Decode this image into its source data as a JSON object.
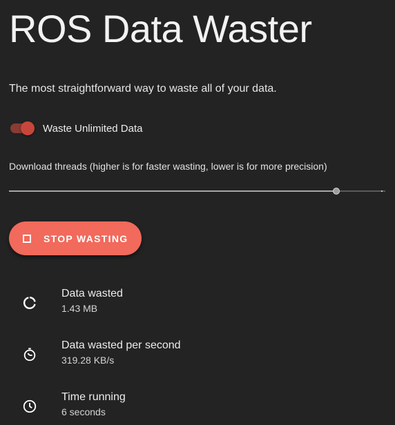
{
  "app": {
    "title": "ROS Data Waster",
    "subtitle": "The most straightforward way to waste all of your data."
  },
  "toggle": {
    "label": "Waste Unlimited Data",
    "checked": true,
    "accent_color": "#c7463c"
  },
  "slider": {
    "label": "Download threads (higher is for faster wasting, lower is for more precision)",
    "level_fraction": 0.87
  },
  "stop_button": {
    "label": "STOP WASTING",
    "icon": "stop-square-icon",
    "color": "#f16a5c"
  },
  "stats": [
    {
      "title": "Data wasted",
      "value": "1.43 MB",
      "icon": "data-usage-icon"
    },
    {
      "title": "Data wasted per second",
      "value": "319.28 KB/s",
      "icon": "speed-timer-icon"
    },
    {
      "title": "Time running",
      "value": "6 seconds",
      "icon": "clock-icon"
    }
  ]
}
